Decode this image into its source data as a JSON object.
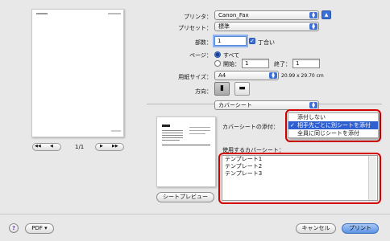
{
  "printer": {
    "label": "プリンタ：",
    "value": "Canon_Fax"
  },
  "preset": {
    "label": "プリセット：",
    "value": "標準"
  },
  "copies": {
    "label": "部数：",
    "value": "1",
    "collate_label": "丁合い"
  },
  "pages": {
    "label": "ページ：",
    "all_label": "すべて",
    "from_label": "開始：",
    "from_value": "1",
    "to_label": "終了：",
    "to_value": "1"
  },
  "paper_size": {
    "label": "用紙サイズ：",
    "value": "A4",
    "dimensions": "20.99 x 29.70 cm"
  },
  "orientation": {
    "label": "方向："
  },
  "section_popup": {
    "value": "カバーシート"
  },
  "attach": {
    "label": "カバーシートの添付：",
    "menu_items": [
      "添付しない",
      "相手先ごとに別シートを添付",
      "全員に同じシートを添付"
    ],
    "selected_index": 1
  },
  "templates": {
    "label": "使用するカバーシート：",
    "items": [
      "テンプレート1",
      "テンプレート2",
      "テンプレート3"
    ]
  },
  "pager": {
    "first": "◀◀",
    "prev": "◀",
    "indicator": "1/1",
    "next": "▶",
    "last": "▶▶"
  },
  "buttons": {
    "sheet_preview": "シートプレビュー",
    "help": "?",
    "pdf": "PDF ▾",
    "cancel": "キャンセル",
    "print": "プリント"
  },
  "colors": {
    "highlight_border": "#d40000",
    "selection": "#2f5fd0",
    "accent": "#3b6fd4"
  }
}
